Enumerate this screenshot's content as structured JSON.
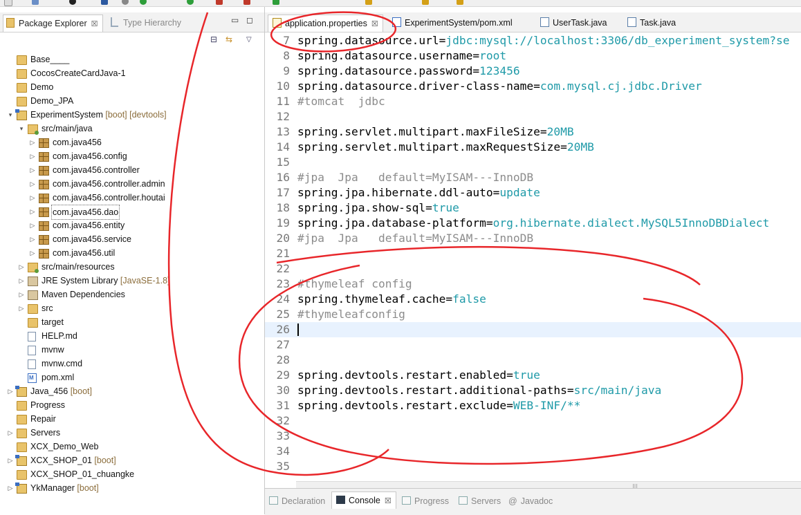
{
  "package_explorer": {
    "tabs": [
      {
        "label": "Package Explorer",
        "close": "☒"
      },
      {
        "label": "Type Hierarchy"
      }
    ],
    "tree": [
      {
        "label": "Base____",
        "icon": "folder-icon",
        "indent": 0,
        "expander": ""
      },
      {
        "label": "CocosCreateCardJava-1",
        "icon": "folder-icon",
        "indent": 0,
        "expander": ""
      },
      {
        "label": "Demo",
        "icon": "folder-icon",
        "indent": 0,
        "expander": ""
      },
      {
        "label": "Demo_JPA",
        "icon": "folder-icon",
        "indent": 0,
        "expander": ""
      },
      {
        "label": "ExperimentSystem",
        "deco": " [boot] [devtools]",
        "icon": "maven-project-icon",
        "indent": 0,
        "expander": "▾"
      },
      {
        "label": "src/main/java",
        "icon": "source-folder-icon",
        "indent": 1,
        "expander": "▾"
      },
      {
        "label": "com.java456",
        "icon": "package-icon",
        "indent": 2,
        "expander": "▷"
      },
      {
        "label": "com.java456.config",
        "icon": "package-icon",
        "indent": 2,
        "expander": "▷"
      },
      {
        "label": "com.java456.controller",
        "icon": "package-icon",
        "indent": 2,
        "expander": "▷"
      },
      {
        "label": "com.java456.controller.admin",
        "icon": "package-icon",
        "indent": 2,
        "expander": "▷"
      },
      {
        "label": "com.java456.controller.houtai",
        "icon": "package-icon",
        "indent": 2,
        "expander": "▷"
      },
      {
        "label": "com.java456.dao",
        "icon": "package-icon",
        "indent": 2,
        "expander": "▷",
        "selected": true
      },
      {
        "label": "com.java456.entity",
        "icon": "package-icon",
        "indent": 2,
        "expander": "▷"
      },
      {
        "label": "com.java456.service",
        "icon": "package-icon",
        "indent": 2,
        "expander": "▷"
      },
      {
        "label": "com.java456.util",
        "icon": "package-icon",
        "indent": 2,
        "expander": "▷"
      },
      {
        "label": "src/main/resources",
        "icon": "source-folder-icon",
        "indent": 1,
        "expander": "▷"
      },
      {
        "label": "JRE System Library",
        "deco": " [JavaSE-1.8]",
        "icon": "library-icon",
        "indent": 1,
        "expander": "▷"
      },
      {
        "label": "Maven Dependencies",
        "icon": "library-icon",
        "indent": 1,
        "expander": "▷"
      },
      {
        "label": "src",
        "icon": "folder-icon",
        "indent": 1,
        "expander": "▷"
      },
      {
        "label": "target",
        "icon": "folder-icon",
        "indent": 1,
        "expander": ""
      },
      {
        "label": "HELP.md",
        "icon": "file-icon",
        "indent": 1,
        "expander": ""
      },
      {
        "label": "mvnw",
        "icon": "file-icon",
        "indent": 1,
        "expander": ""
      },
      {
        "label": "mvnw.cmd",
        "icon": "file-icon",
        "indent": 1,
        "expander": ""
      },
      {
        "label": "pom.xml",
        "icon": "xml-file-icon",
        "indent": 1,
        "expander": ""
      },
      {
        "label": "Java_456",
        "deco": " [boot]",
        "icon": "maven-project-icon",
        "indent": 0,
        "expander": "▷"
      },
      {
        "label": "Progress",
        "icon": "folder-icon",
        "indent": 0,
        "expander": ""
      },
      {
        "label": "Repair",
        "icon": "folder-icon",
        "indent": 0,
        "expander": ""
      },
      {
        "label": "Servers",
        "icon": "folder-icon",
        "indent": 0,
        "expander": "▷"
      },
      {
        "label": "XCX_Demo_Web",
        "icon": "folder-icon",
        "indent": 0,
        "expander": ""
      },
      {
        "label": "XCX_SHOP_01",
        "deco": " [boot]",
        "icon": "maven-project-icon",
        "indent": 0,
        "expander": "▷"
      },
      {
        "label": "XCX_SHOP_01_chuangke",
        "icon": "folder-icon",
        "indent": 0,
        "expander": ""
      },
      {
        "label": "YkManager",
        "deco": " [boot]",
        "icon": "maven-project-icon",
        "indent": 0,
        "expander": "▷"
      }
    ]
  },
  "editor": {
    "tabs": [
      {
        "label": "application.properties",
        "icon": "properties-file-icon",
        "active": true
      },
      {
        "label": "ExperimentSystem/pom.xml",
        "icon": "maven-pom-icon"
      },
      {
        "label": "UserTask.java",
        "icon": "java-file-icon"
      },
      {
        "label": "Task.java",
        "icon": "java-file-icon"
      }
    ],
    "lines": [
      {
        "n": "7",
        "key": "spring.datasource.url",
        "val": "jdbc:mysql://localhost:3306/db_experiment_system?se"
      },
      {
        "n": "8",
        "key": "spring.datasource.username",
        "val": "root"
      },
      {
        "n": "9",
        "key": "spring.datasource.password",
        "val": "123456"
      },
      {
        "n": "10",
        "key": "spring.datasource.driver-class-name",
        "val": "com.mysql.cj.jdbc.Driver"
      },
      {
        "n": "11",
        "comment": "#tomcat  jdbc"
      },
      {
        "n": "12"
      },
      {
        "n": "13",
        "key": "spring.servlet.multipart.maxFileSize",
        "val": "20MB"
      },
      {
        "n": "14",
        "key": "spring.servlet.multipart.maxRequestSize",
        "val": "20MB"
      },
      {
        "n": "15"
      },
      {
        "n": "16",
        "comment": "#jpa  Jpa   default=MyISAM---InnoDB"
      },
      {
        "n": "17",
        "key": "spring.jpa.hibernate.ddl-auto",
        "val": "update"
      },
      {
        "n": "18",
        "key": "spring.jpa.show-sql",
        "val": "true"
      },
      {
        "n": "19",
        "key": "spring.jpa.database-platform",
        "val": "org.hibernate.dialect.MySQL5InnoDBDialect"
      },
      {
        "n": "20",
        "comment": "#jpa  Jpa   default=MyISAM---InnoDB"
      },
      {
        "n": "21"
      },
      {
        "n": "22"
      },
      {
        "n": "23",
        "comment": "#thymeleaf config"
      },
      {
        "n": "24",
        "key": "spring.thymeleaf.cache",
        "val": "false"
      },
      {
        "n": "25",
        "comment": "#thymeleafconfig"
      },
      {
        "n": "26",
        "cursor": true
      },
      {
        "n": "27"
      },
      {
        "n": "28"
      },
      {
        "n": "29",
        "key": "spring.devtools.restart.enabled",
        "val": "true"
      },
      {
        "n": "30",
        "key": "spring.devtools.restart.additional-paths",
        "val": "src/main/java"
      },
      {
        "n": "31",
        "key": "spring.devtools.restart.exclude",
        "val": "WEB-INF/**"
      },
      {
        "n": "32"
      },
      {
        "n": "33"
      },
      {
        "n": "34"
      },
      {
        "n": "35"
      }
    ]
  },
  "bottom_panel": {
    "tabs": [
      {
        "label": "Declaration",
        "icon": "declaration-icon"
      },
      {
        "label": "Console",
        "icon": "console-icon",
        "active": true,
        "close": "☒"
      },
      {
        "label": "Progress",
        "icon": "progress-icon"
      },
      {
        "label": "Servers",
        "icon": "servers-icon"
      },
      {
        "label": "Javadoc",
        "icon": "javadoc-icon"
      }
    ]
  },
  "colors": {
    "annotation": "#e8262a",
    "value": "#1f9aa8",
    "comment": "#8c8c8c",
    "current_line": "#e8f2fe"
  }
}
